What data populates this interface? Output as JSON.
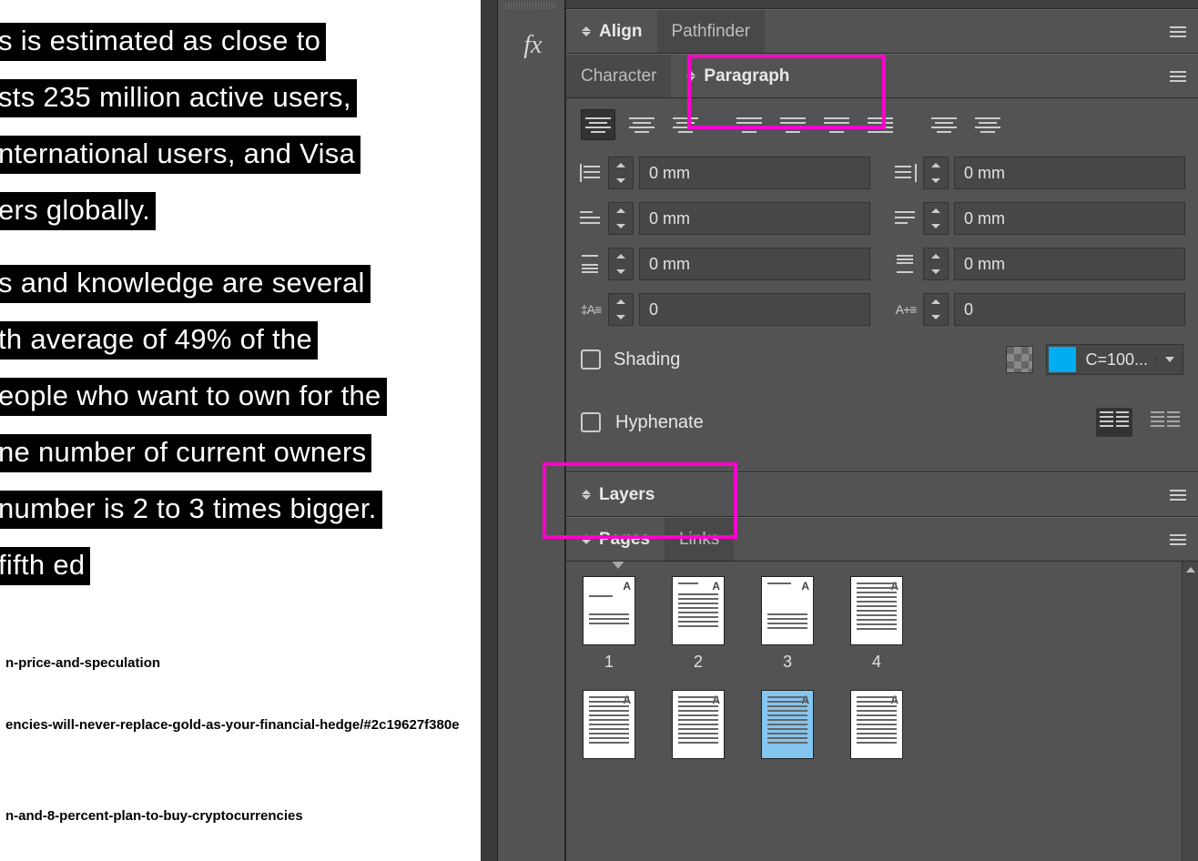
{
  "document": {
    "lines": [
      "s is estimated as close to",
      "sts 235 million active users,",
      "nternational users, and Visa",
      "ers globally.",
      "s and knowledge are several",
      "th average of 49% of the",
      "eople who want to own for the",
      "ne number of current owners",
      "number is 2 to 3 times bigger.",
      "fifth ed"
    ],
    "refs": [
      "n-price-and-speculation",
      "encies-will-never-replace-gold-as-your-financial-hedge/#2c19627f380e",
      "n-and-8-percent-plan-to-buy-cryptocurrencies"
    ]
  },
  "gutter": {
    "fx_label": "fx"
  },
  "panels": {
    "align_tab": "Align",
    "pathfinder_tab": "Pathfinder",
    "character_tab": "Character",
    "paragraph_tab": "Paragraph",
    "indent_left": "0 mm",
    "indent_right": "0 mm",
    "first_line": "0 mm",
    "last_line": "0 mm",
    "space_before": "0 mm",
    "space_after": "0 mm",
    "dropcap_lines": "0",
    "dropcap_chars": "0",
    "shading_label": "Shading",
    "swatch_text": "C=100...",
    "hyphenate_label": "Hyphenate",
    "layers_tab": "Layers",
    "pages_tab": "Pages",
    "links_tab": "Links",
    "page_numbers": [
      "1",
      "2",
      "3",
      "4"
    ]
  }
}
